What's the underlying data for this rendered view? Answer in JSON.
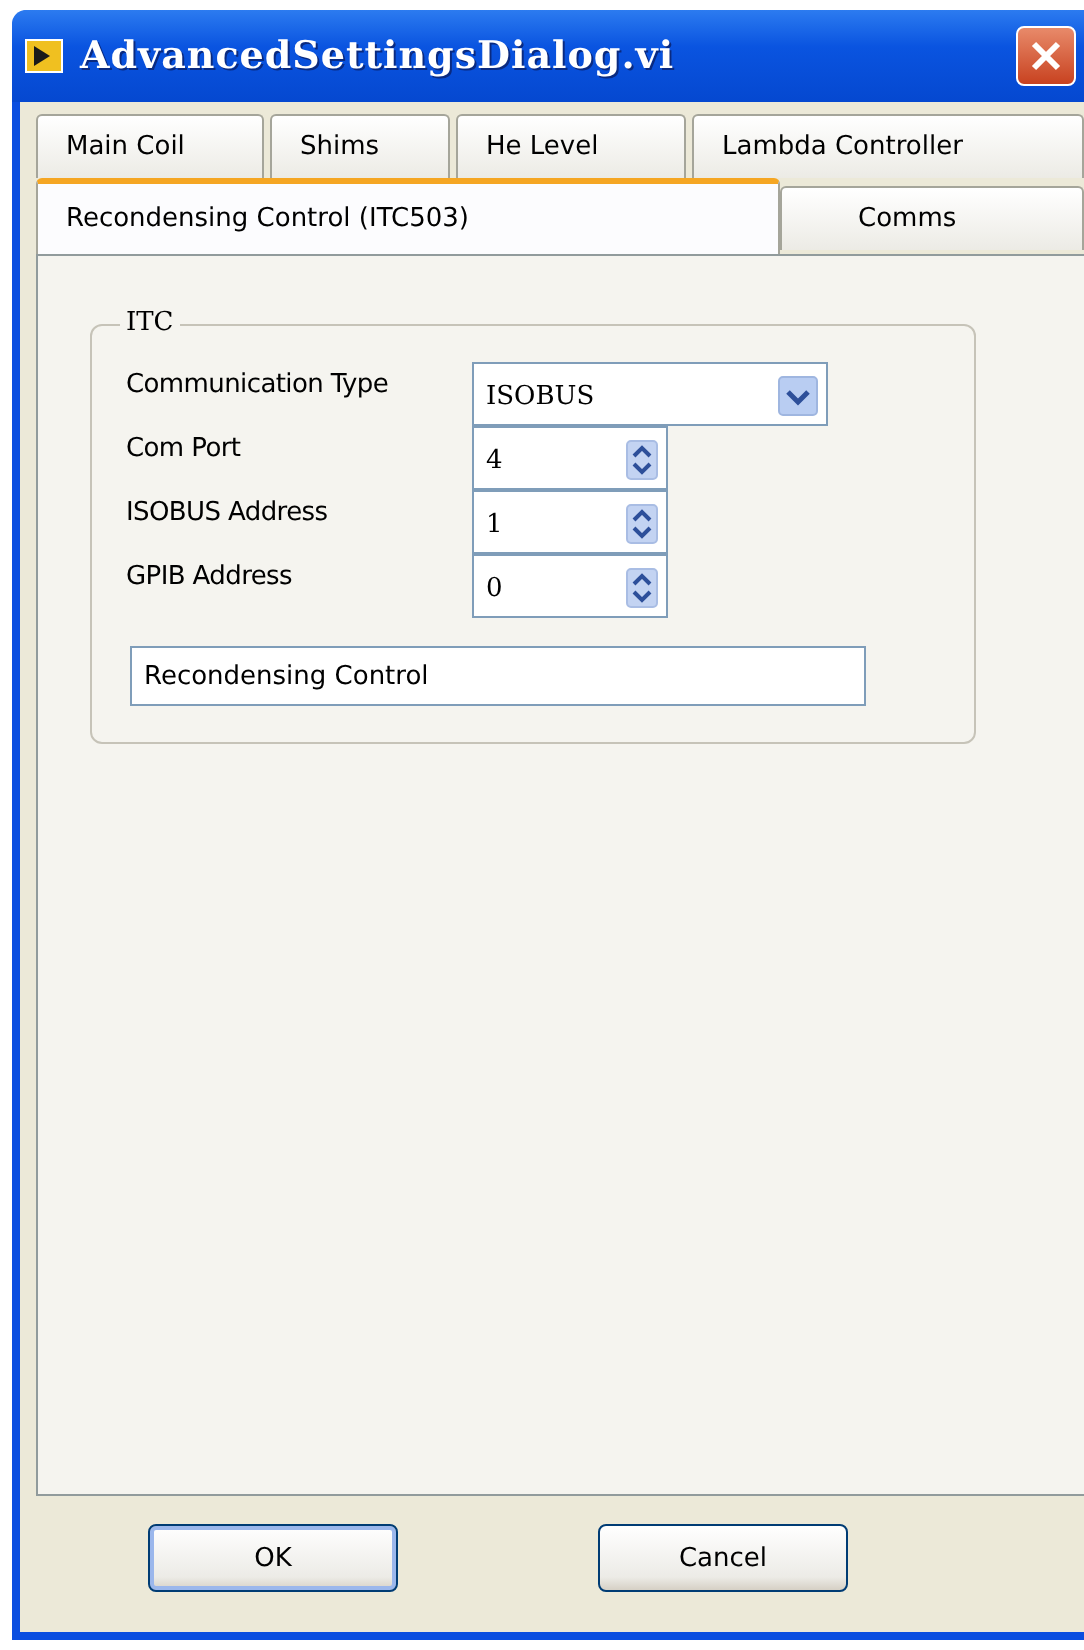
{
  "window": {
    "title": "AdvancedSettingsDialog.vi"
  },
  "tab_rows": [
    {
      "tabs": [
        {
          "label": "Main Coil",
          "selected": false
        },
        {
          "label": "Shims",
          "selected": false
        },
        {
          "label": "He Level",
          "selected": false
        },
        {
          "label": "Lambda Controller",
          "selected": false
        }
      ]
    },
    {
      "tabs": [
        {
          "label": "Recondensing Control (ITC503)",
          "selected": true
        },
        {
          "label": "Comms",
          "selected": false
        }
      ]
    }
  ],
  "group": {
    "title": "ITC",
    "fields": [
      {
        "kind": "dropdown",
        "label": "Communication Type",
        "value": "ISOBUS"
      },
      {
        "kind": "spinner",
        "label": "Com Port",
        "value": "4"
      },
      {
        "kind": "spinner",
        "label": "ISOBUS Address",
        "value": "1"
      },
      {
        "kind": "spinner",
        "label": "GPIB Address",
        "value": "0"
      }
    ],
    "text_field": {
      "value": "Recondensing Control"
    }
  },
  "buttons": [
    {
      "label": "OK",
      "default": true
    },
    {
      "label": "Cancel",
      "default": false
    }
  ]
}
